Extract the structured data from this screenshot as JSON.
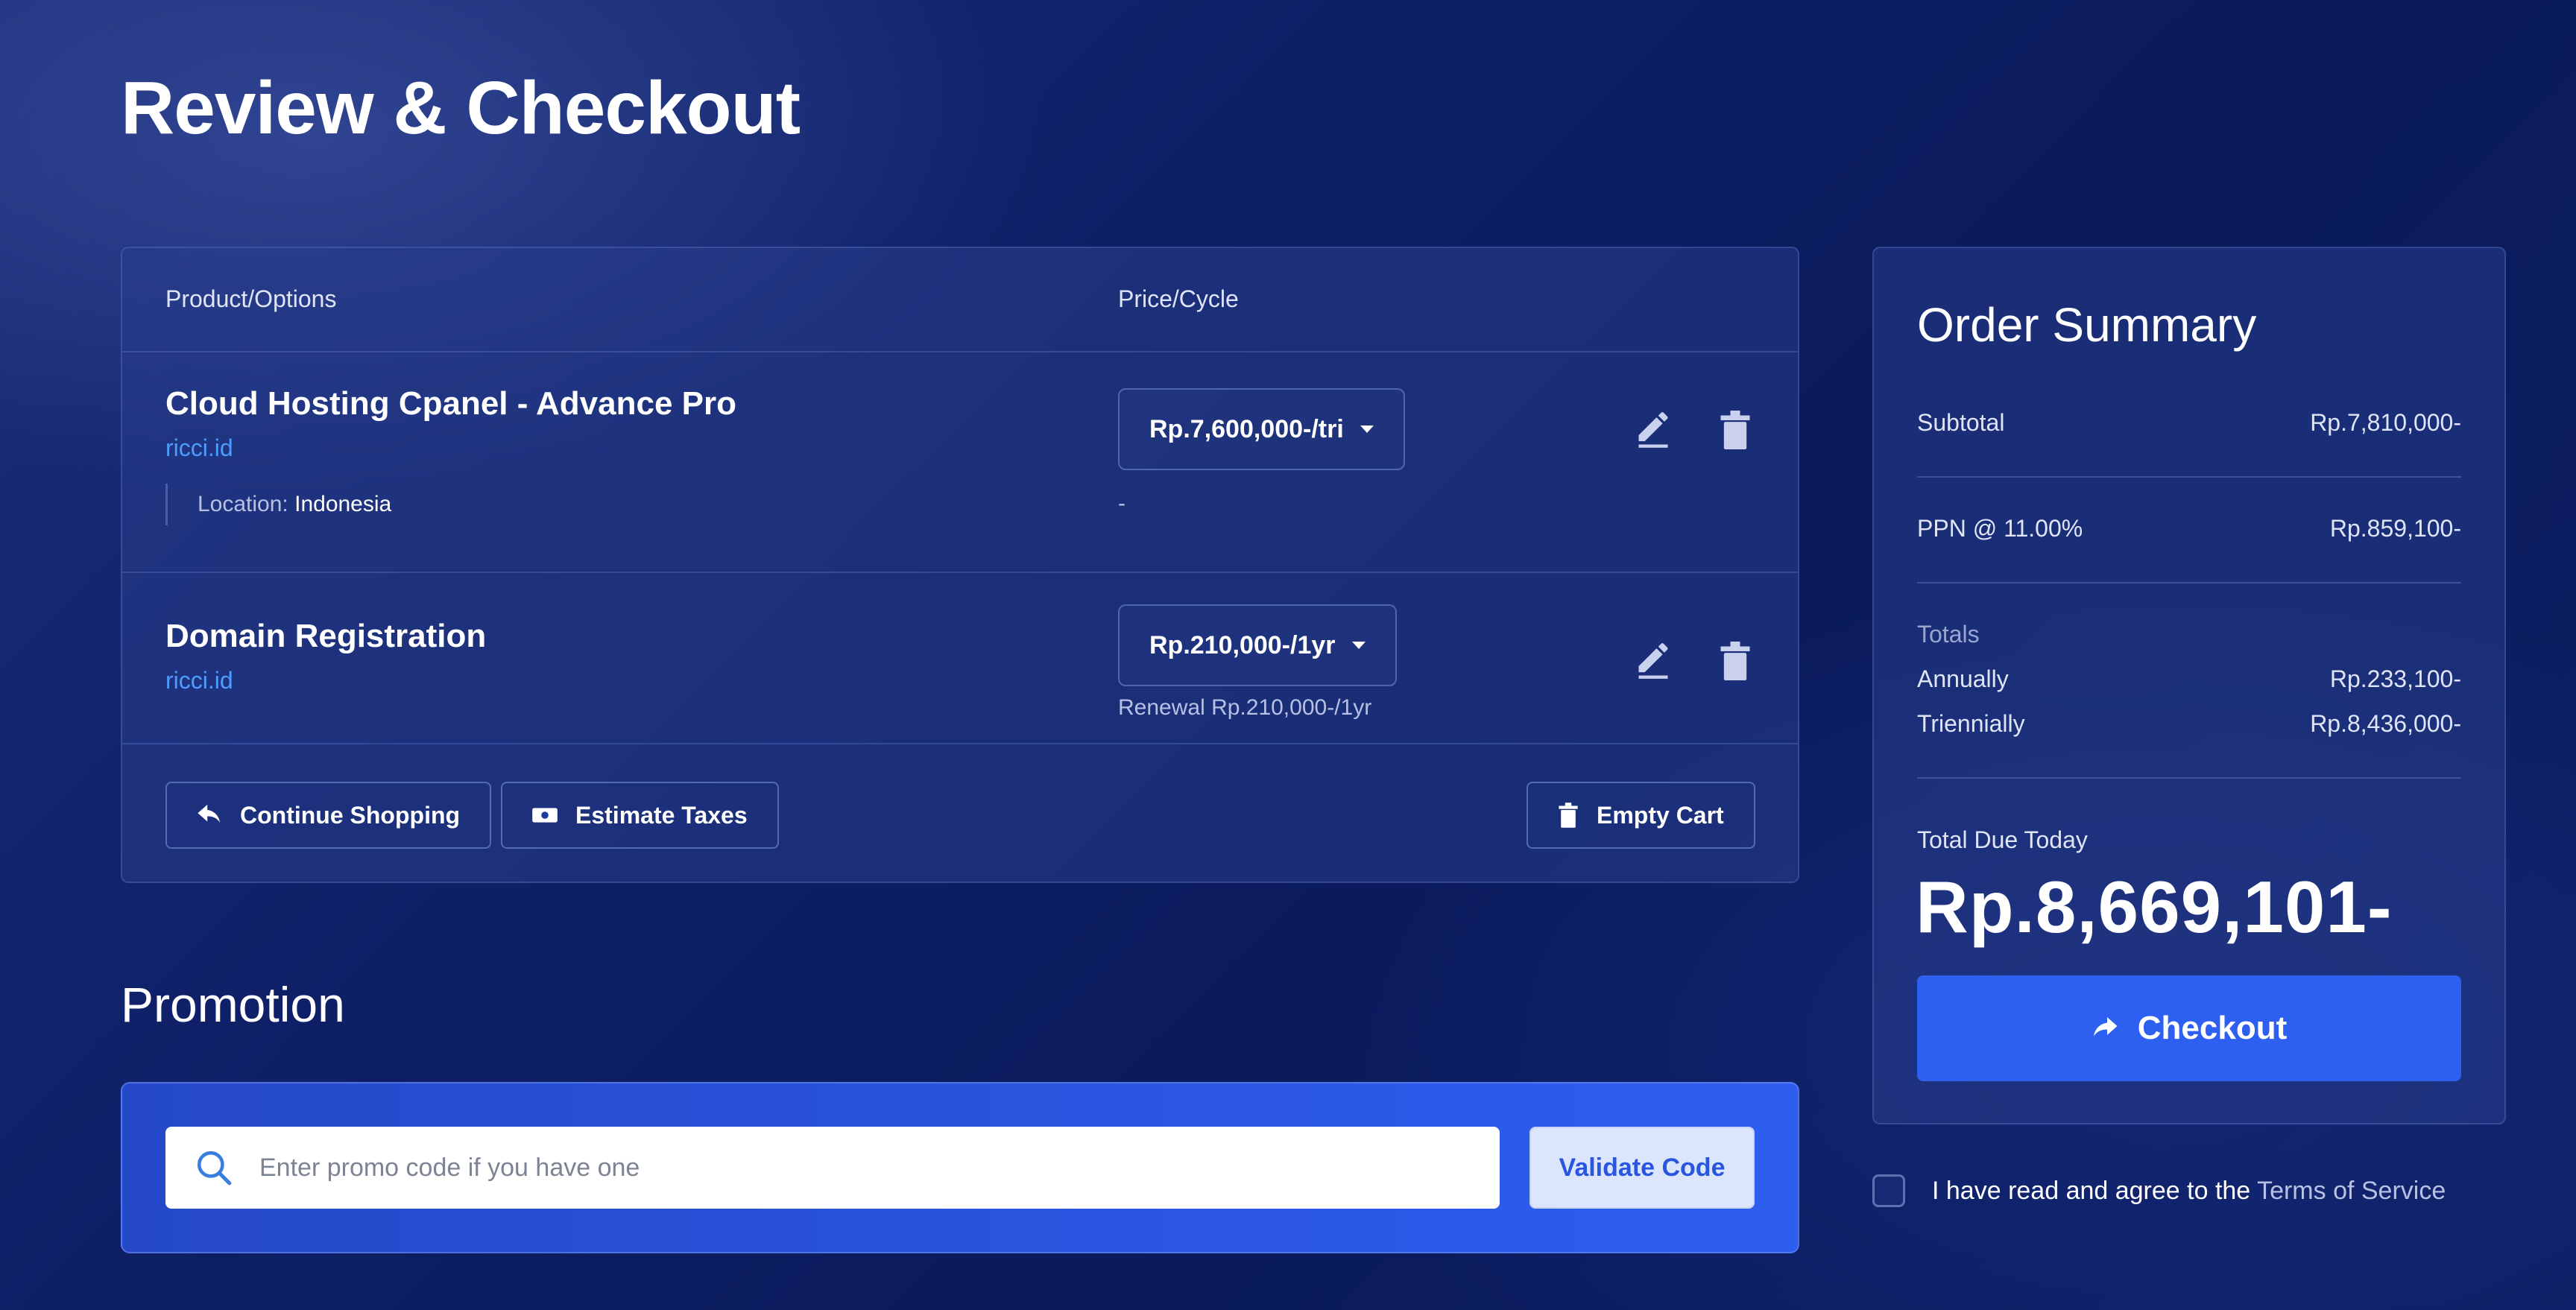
{
  "page": {
    "title": "Review & Checkout"
  },
  "cart": {
    "columns": {
      "product": "Product/Options",
      "price": "Price/Cycle"
    },
    "items": [
      {
        "name": "Cloud Hosting Cpanel - Advance Pro",
        "domain": "ricci.id",
        "option_label": "Location:",
        "option_value": "Indonesia",
        "cycle": "Rp.7,600,000-/tri",
        "note": "-"
      },
      {
        "name": "Domain Registration",
        "domain": "ricci.id",
        "cycle": "Rp.210,000-/1yr",
        "note": "Renewal Rp.210,000-/1yr"
      }
    ],
    "actions": {
      "continue": "Continue Shopping",
      "estimate": "Estimate Taxes",
      "empty": "Empty Cart"
    }
  },
  "promotion": {
    "title": "Promotion",
    "placeholder": "Enter promo code if you have one",
    "validate": "Validate Code"
  },
  "summary": {
    "title": "Order Summary",
    "subtotal_label": "Subtotal",
    "subtotal_value": "Rp.7,810,000-",
    "tax_label": "PPN @ 11.00%",
    "tax_value": "Rp.859,100-",
    "totals_label": "Totals",
    "annually_label": "Annually",
    "annually_value": "Rp.233,100-",
    "triennially_label": "Triennially",
    "triennially_value": "Rp.8,436,000-",
    "due_label": "Total Due Today",
    "due_value": "Rp.8,669,101-",
    "checkout": "Checkout"
  },
  "tos": {
    "text": "I have read and agree to the",
    "link": "Terms of Service"
  },
  "colors": {
    "accent": "#2d60f0",
    "link": "#4d9cff",
    "background": "#0e1f66"
  }
}
